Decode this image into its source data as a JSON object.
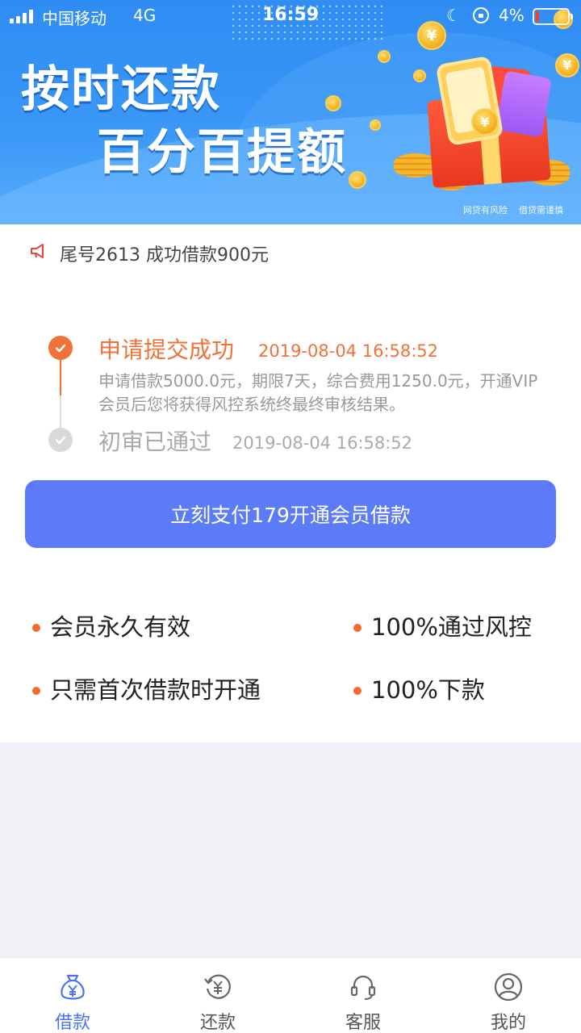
{
  "status_bar": {
    "carrier": "中国移动",
    "network": "4G",
    "time": "16:59",
    "battery": "4%"
  },
  "banner": {
    "headline_line1": "按时还款",
    "headline_line2": "百分百提额",
    "disclaimer_1": "网贷有风险",
    "disclaimer_2": "借贷需谨慎",
    "coin_symbol": "¥"
  },
  "notice": {
    "text": "尾号2613 成功借款900元",
    "icon": "speaker-icon"
  },
  "steps": [
    {
      "title": "申请提交成功",
      "time": "2019-08-04 16:58:52",
      "desc": "申请借款5000.0元，期限7天，综合费用1250.0元，开通VIP会员后您将获得风控系统终最终审核结果。",
      "status": "done"
    },
    {
      "title": "初审已通过",
      "time": "2019-08-04 16:58:52",
      "status": "pending"
    }
  ],
  "pay_button": {
    "label": "立刻支付179开通会员借款"
  },
  "features": [
    "会员永久有效",
    "100%通过风控",
    "只需首次借款时开通",
    "100%下款"
  ],
  "tabbar": {
    "items": [
      {
        "label": "借款",
        "icon": "loan-bag-icon",
        "active": true
      },
      {
        "label": "还款",
        "icon": "repay-icon",
        "active": false
      },
      {
        "label": "客服",
        "icon": "headset-icon",
        "active": false
      },
      {
        "label": "我的",
        "icon": "profile-icon",
        "active": false
      }
    ]
  },
  "colors": {
    "accent": "#f07238",
    "button": "#5b7bf8",
    "tab_active": "#4a72f5",
    "banner": "#2f8cf3"
  }
}
